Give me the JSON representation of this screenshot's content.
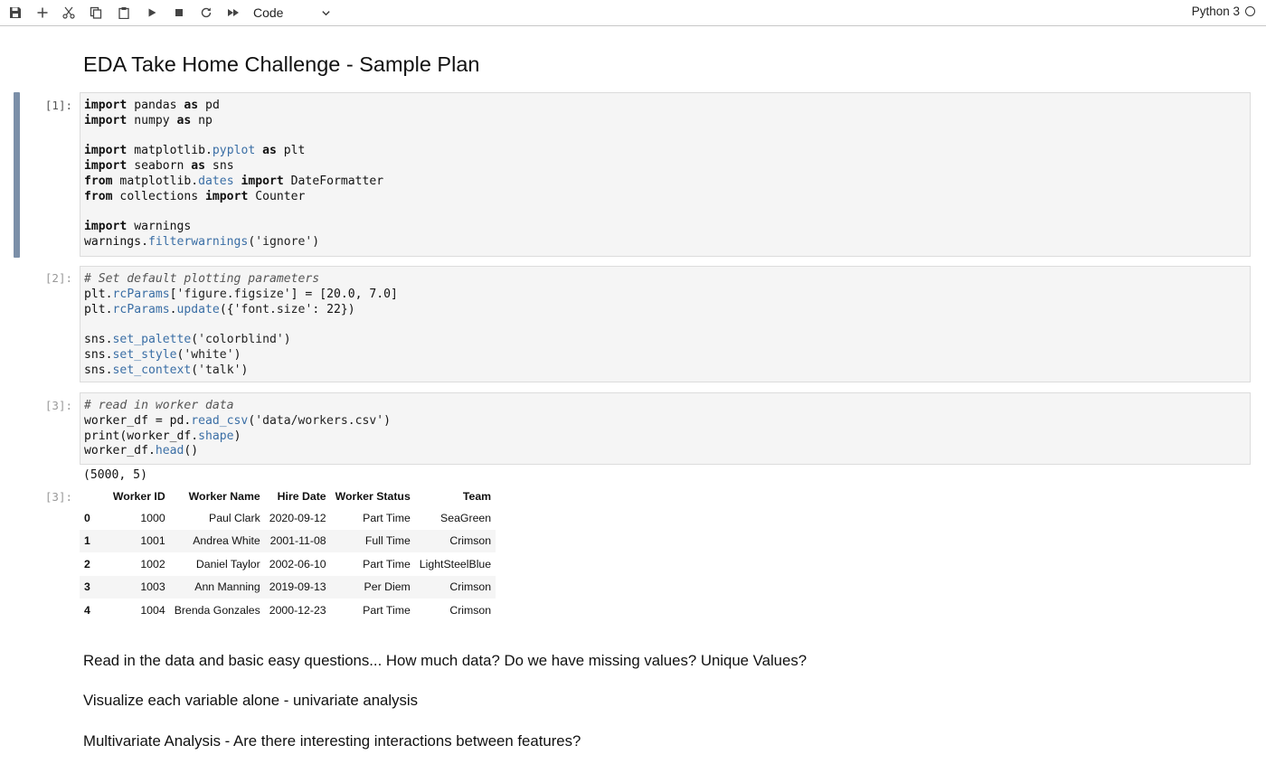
{
  "toolbar": {
    "buttons": [
      {
        "name": "save-icon"
      },
      {
        "name": "plus-icon"
      },
      {
        "name": "scissors-icon"
      },
      {
        "name": "copy-icon"
      },
      {
        "name": "paste-icon"
      },
      {
        "name": "run-icon"
      },
      {
        "name": "stop-icon"
      },
      {
        "name": "restart-icon"
      },
      {
        "name": "fast-forward-icon"
      }
    ],
    "cell_type": "Code",
    "kernel_name": "Python 3"
  },
  "notebook": {
    "title": "EDA Take Home Challenge - Sample Plan",
    "cells": [
      {
        "prompt": "[1]:"
      },
      {
        "prompt": "[2]:"
      },
      {
        "prompt": "[3]:"
      }
    ],
    "output_prompt": "[3]:",
    "shape_output": "(5000, 5)",
    "dataframe": {
      "columns": [
        "",
        "Worker ID",
        "Worker Name",
        "Hire Date",
        "Worker Status",
        "Team"
      ],
      "rows": [
        [
          "0",
          "1000",
          "Paul Clark",
          "2020-09-12",
          "Part Time",
          "SeaGreen"
        ],
        [
          "1",
          "1001",
          "Andrea White",
          "2001-11-08",
          "Full Time",
          "Crimson"
        ],
        [
          "2",
          "1002",
          "Daniel Taylor",
          "2002-06-10",
          "Part Time",
          "LightSteelBlue"
        ],
        [
          "3",
          "1003",
          "Ann Manning",
          "2019-09-13",
          "Per Diem",
          "Crimson"
        ],
        [
          "4",
          "1004",
          "Brenda Gonzales",
          "2000-12-23",
          "Part Time",
          "Crimson"
        ]
      ]
    },
    "markdown": [
      "Read in the data and basic easy questions... How much data? Do we have missing values? Unique Values?",
      "Visualize each variable alone - univariate analysis",
      "Multivariate Analysis - Are there interesting interactions between features?"
    ]
  },
  "colors": {
    "active_cell_bar": "#7b8fa8",
    "cell_background": "#f5f5f5",
    "attribute_blue": "#3a6ea5"
  }
}
